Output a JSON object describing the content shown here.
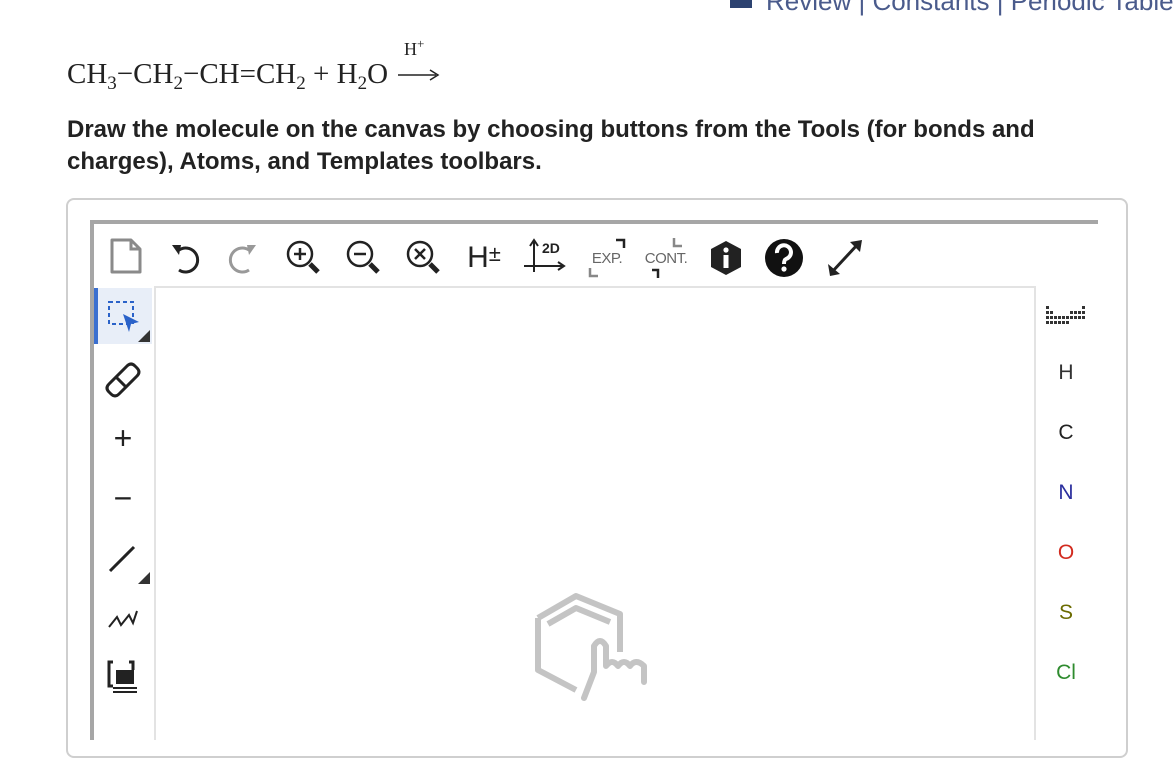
{
  "top_links": {
    "text": "Review | Constants | Periodic Table"
  },
  "reaction": {
    "r1": "CH",
    "r1_sub": "3",
    "d1": "−",
    "r2": "CH",
    "r2_sub": "2",
    "d2": "−",
    "r3": "CH",
    "eq": "=",
    "r4": "CH",
    "r4_sub": "2",
    "plus": " + ",
    "water_h": "H",
    "water_sub": "2",
    "water_o": "O",
    "catalyst": "H",
    "catalyst_sup": "+"
  },
  "instructions": "Draw the molecule on the canvas by choosing buttons from the Tools (for bonds and charges), Atoms, and Templates toolbars.",
  "toolbar": {
    "h_label": "H",
    "h_sign": "±",
    "twod_label": "2D",
    "exp_label": "EXP.",
    "cont_label": "CONT."
  },
  "left_tools": {
    "plus_label": "+",
    "minus_label": "−"
  },
  "atoms": [
    {
      "symbol": "H",
      "color": "#333333"
    },
    {
      "symbol": "C",
      "color": "#222222"
    },
    {
      "symbol": "N",
      "color": "#2b2f9e"
    },
    {
      "symbol": "O",
      "color": "#d22b1f"
    },
    {
      "symbol": "S",
      "color": "#6b6b00"
    },
    {
      "symbol": "Cl",
      "color": "#2e8b2e"
    }
  ]
}
